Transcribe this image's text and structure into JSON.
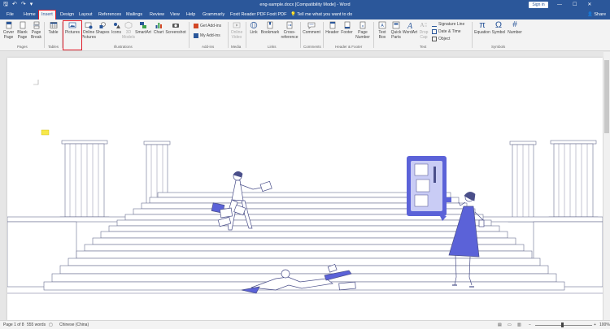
{
  "window": {
    "title": "eng-sample.docx [Compatibility Mode] - Word",
    "sign_in": "Sign in",
    "share": "Share",
    "controls": [
      "—",
      "☐",
      "✕"
    ]
  },
  "tabs": [
    "File",
    "Home",
    "Insert",
    "Design",
    "Layout",
    "References",
    "Mailings",
    "Review",
    "View",
    "Help",
    "Grammarly",
    "Foxit Reader PDF",
    "Foxit PDF"
  ],
  "active_tab": "Insert",
  "tell_me": "Tell me what you want to do",
  "ribbon": {
    "pages": {
      "cover": "Cover\nPage",
      "blank": "Blank\nPage",
      "break": "Page\nBreak",
      "label": "Pages"
    },
    "tables": {
      "table": "Table",
      "label": "Tables"
    },
    "illustrations": {
      "pictures": "Pictures",
      "online": "Online\nPictures",
      "shapes": "Shapes",
      "icons": "Icons",
      "models": "3D\nModels",
      "smartart": "SmartArt",
      "chart": "Chart",
      "screenshot": "Screenshot",
      "label": "Illustrations"
    },
    "addins": {
      "get": "Get Add-ins",
      "my": "My Add-ins",
      "label": "Add-ins"
    },
    "media": {
      "video": "Online\nVideo",
      "label": "Media"
    },
    "links": {
      "link": "Link",
      "bookmark": "Bookmark",
      "crossref": "Cross-\nreference",
      "label": "Links"
    },
    "comments": {
      "comment": "Comment",
      "label": "Comments"
    },
    "header_footer": {
      "header": "Header",
      "footer": "Footer",
      "page_number": "Page\nNumber",
      "label": "Header & Footer"
    },
    "text": {
      "textbox": "Text\nBox",
      "quickparts": "Quick\nParts",
      "wordart": "WordArt",
      "dropcap": "Drop\nCap",
      "signature": "Signature Line",
      "datetime": "Date & Time",
      "object": "Object",
      "label": "Text"
    },
    "symbols": {
      "equation": "Equation",
      "symbol": "Symbol",
      "number": "Number",
      "label": "Symbols"
    }
  },
  "status": {
    "page": "Page 1 of 8",
    "words": "555 words",
    "language": "Chinese (China)",
    "zoom": "100%"
  },
  "colors": {
    "brand": "#2b579a",
    "highlight": "#e0202e",
    "illustration": "#5b62d8"
  }
}
